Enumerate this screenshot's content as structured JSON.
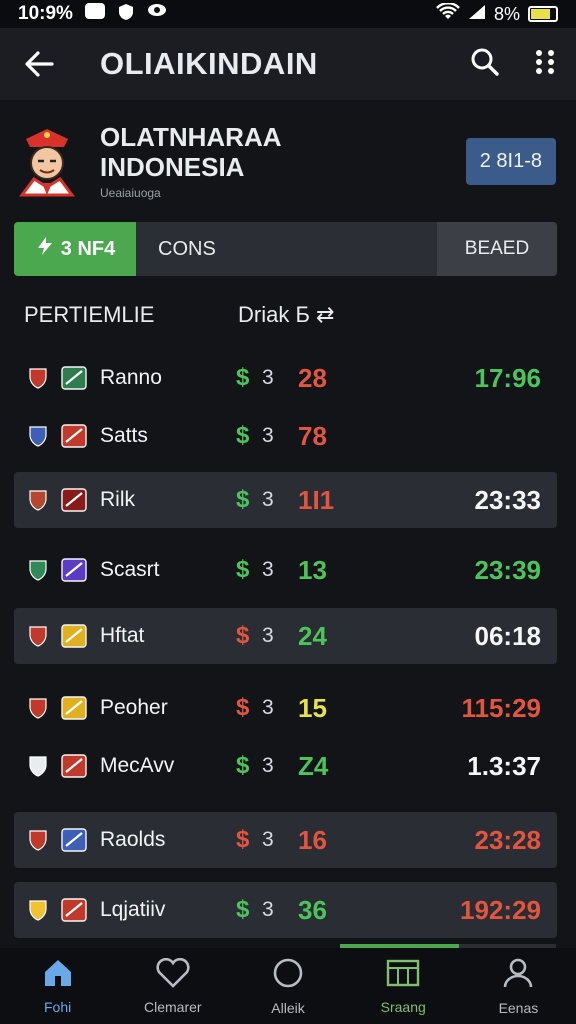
{
  "status_bar": {
    "time": "10:9%",
    "battery": "8%",
    "battery_level": 0.8
  },
  "app_bar": {
    "title": "OLIAIKINDAIN",
    "back_icon": "arrow-left-icon",
    "search_icon": "search-icon",
    "more_icon": "more-grid-icon"
  },
  "league": {
    "title_line1": "OLATNHARAA",
    "title_line2": "INDONESIA",
    "subtitle": "Ueaiaiuoga",
    "badge": "2 8I1-8"
  },
  "tabs": {
    "active": "3 NF4",
    "middle": "CONS",
    "right": "BEAED"
  },
  "list": {
    "header_col1": "PERTIEMLIE",
    "header_col2": "Driak Б ⇄",
    "rows": [
      {
        "name": "Ranno",
        "dollar": "$",
        "dollar_color": "#4cc45b",
        "num": "3",
        "score": "28",
        "score_color": "#e4553f",
        "time": "17:96",
        "time_color": "#4cc45b",
        "highlight": false
      },
      {
        "name": "Satts",
        "dollar": "$",
        "dollar_color": "#4cc45b",
        "num": "3",
        "score": "78",
        "score_color": "#e4553f",
        "time": "",
        "time_color": "#f5f6f7",
        "highlight": false
      },
      {
        "name": "Rilk",
        "dollar": "$",
        "dollar_color": "#4cc45b",
        "num": "3",
        "score": "1I1",
        "score_color": "#e4553f",
        "time": "23:33",
        "time_color": "#f5f6f7",
        "highlight": true
      },
      {
        "name": "Scasrt",
        "dollar": "$",
        "dollar_color": "#4cc45b",
        "num": "3",
        "score": "13",
        "score_color": "#4cc45b",
        "time": "23:39",
        "time_color": "#4cc45b",
        "highlight": false
      },
      {
        "name": "Hftat",
        "dollar": "$",
        "dollar_color": "#e4553f",
        "num": "3",
        "score": "24",
        "score_color": "#4cc45b",
        "time": "06:18",
        "time_color": "#f5f6f7",
        "highlight": true
      },
      {
        "name": "Peoher",
        "dollar": "$",
        "dollar_color": "#e4553f",
        "num": "3",
        "score": "15",
        "score_color": "#e7e247",
        "time": "115:29",
        "time_color": "#e4553f",
        "highlight": false
      },
      {
        "name": "MecAvv",
        "dollar": "$",
        "dollar_color": "#4cc45b",
        "num": "3",
        "score": "Z4",
        "score_color": "#4cc45b",
        "time": "1.3:37",
        "time_color": "#f5f6f7",
        "highlight": false
      },
      {
        "name": "Raolds",
        "dollar": "$",
        "dollar_color": "#e4553f",
        "num": "3",
        "score": "16",
        "score_color": "#e4553f",
        "time": "23:28",
        "time_color": "#e4553f",
        "highlight": true
      },
      {
        "name": "Lqjatiiv",
        "dollar": "$",
        "dollar_color": "#4cc45b",
        "num": "3",
        "score": "36",
        "score_color": "#4cc45b",
        "time": "192:29",
        "time_color": "#e4553f",
        "highlight": true
      }
    ]
  },
  "bottom_nav": [
    {
      "label": "Fohi",
      "icon": "home-icon"
    },
    {
      "label": "Clemarer",
      "icon": "heart-icon"
    },
    {
      "label": "Alleik",
      "icon": "circle-icon"
    },
    {
      "label": "Sraang",
      "icon": "standings-icon"
    },
    {
      "label": "Eenas",
      "icon": "profile-icon"
    }
  ],
  "colors": {
    "accent_green": "#4ba84f",
    "badge_blue": "#3b5b8a",
    "red": "#e4553f",
    "green": "#4cc45b",
    "yellow": "#e7e247"
  }
}
